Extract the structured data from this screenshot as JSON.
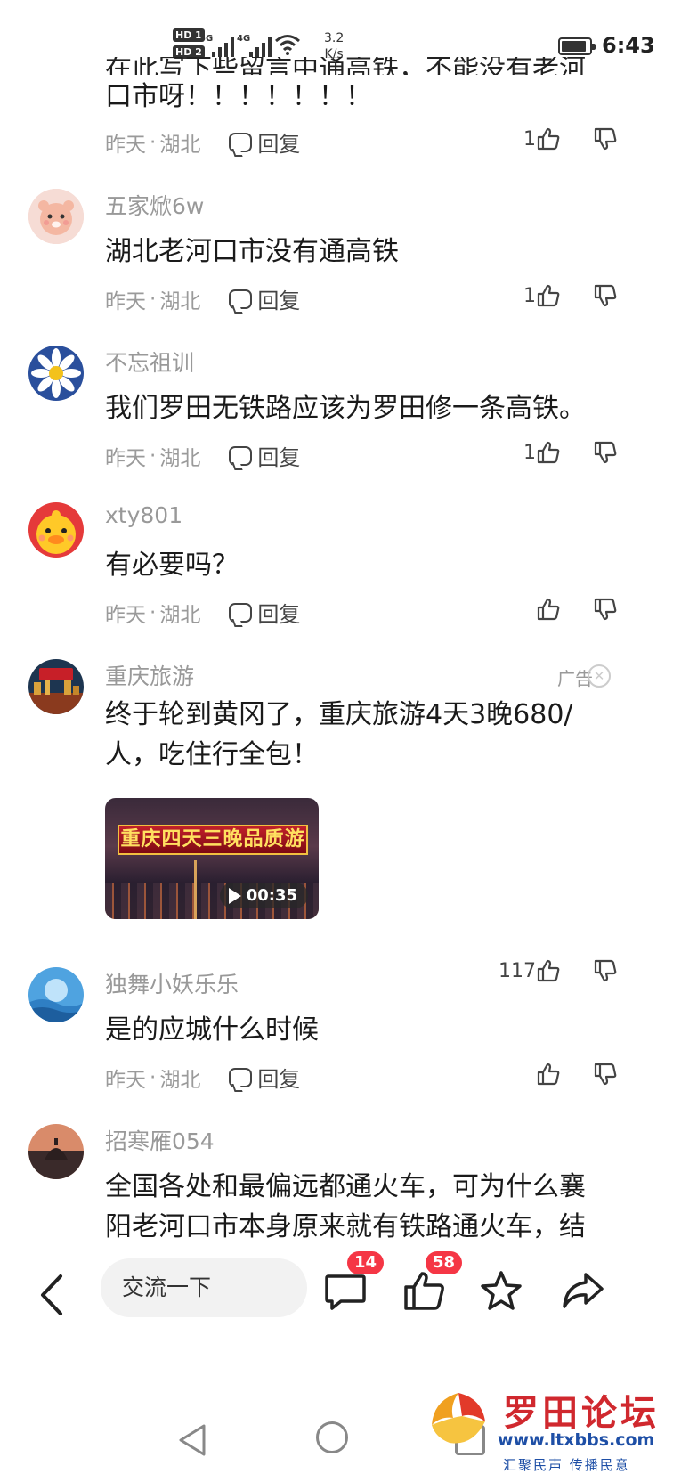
{
  "status_bar": {
    "hd1": "HD 1",
    "hd2": "HD 2",
    "net1": "5G",
    "net2": "4G",
    "speed_value": "3.2",
    "speed_unit": "K/s",
    "time": "6:43",
    "battery_level": 0.9
  },
  "partial_top": {
    "cut_text": "在此写下些留言中通高铁，不能没有老河",
    "text": "口市呀！！！！！！！",
    "time": "昨天",
    "location": "湖北",
    "reply_label": "回复",
    "like_count": "1"
  },
  "comments": [
    {
      "username": "五家焮6w",
      "text": "湖北老河口市没有通高铁",
      "time": "昨天",
      "location": "湖北",
      "reply_label": "回复",
      "like_count": "1"
    },
    {
      "username": "不忘祖训",
      "text": "我们罗田无铁路应该为罗田修一条高铁。",
      "time": "昨天",
      "location": "湖北",
      "reply_label": "回复",
      "like_count": "1"
    },
    {
      "username": "xty801",
      "text": "有必要吗？",
      "time": "昨天",
      "location": "湖北",
      "reply_label": "回复",
      "like_count": ""
    }
  ],
  "ad": {
    "username": "重庆旅游",
    "tag": "广告",
    "text_line1": "终于轮到黄冈了，重庆旅游4天3晚680/",
    "text_line2": "人，吃住行全包！",
    "video_banner": "重庆四天三晚品质游",
    "video_duration": "00:35",
    "like_count": "117"
  },
  "comments2": [
    {
      "username": "独舞小妖乐乐",
      "text": "是的应城什么时候",
      "time": "昨天",
      "location": "湖北",
      "reply_label": "回复",
      "like_count": ""
    },
    {
      "username": "招寒雁054",
      "text_line1": "全国各处和最偏远都通火车，可为什么襄",
      "text_line2": "阳老河口市本身原来就有铁路通火车，结"
    }
  ],
  "bottom_bar": {
    "input_placeholder": "交流一下",
    "comment_badge": "14",
    "like_badge": "58"
  },
  "watermark": {
    "title": "罗田论坛",
    "url": "www.ltxbbs.com",
    "slogan": "汇聚民声 传播民意"
  }
}
